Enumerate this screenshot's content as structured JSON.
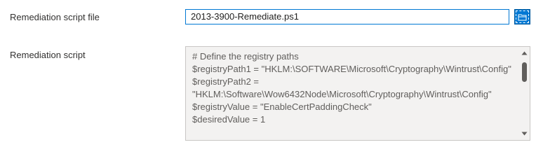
{
  "form": {
    "file_label": "Remediation script file",
    "file_value": "2013-3900-Remediate.ps1",
    "script_label": "Remediation script",
    "browse_icon": "folder-open-icon",
    "script_lines": [
      "# Define the registry paths",
      "$registryPath1 = \"HKLM:\\SOFTWARE\\Microsoft\\Cryptography\\Wintrust\\Config\"",
      "$registryPath2 =",
      "\"HKLM:\\Software\\Wow6432Node\\Microsoft\\Cryptography\\Wintrust\\Config\"",
      "$registryValue = \"EnableCertPaddingCheck\"",
      "$desiredValue = 1"
    ]
  },
  "colors": {
    "accent": "#0078d4",
    "disabled_bg": "#f3f2f1",
    "border": "#c8c6c4"
  }
}
